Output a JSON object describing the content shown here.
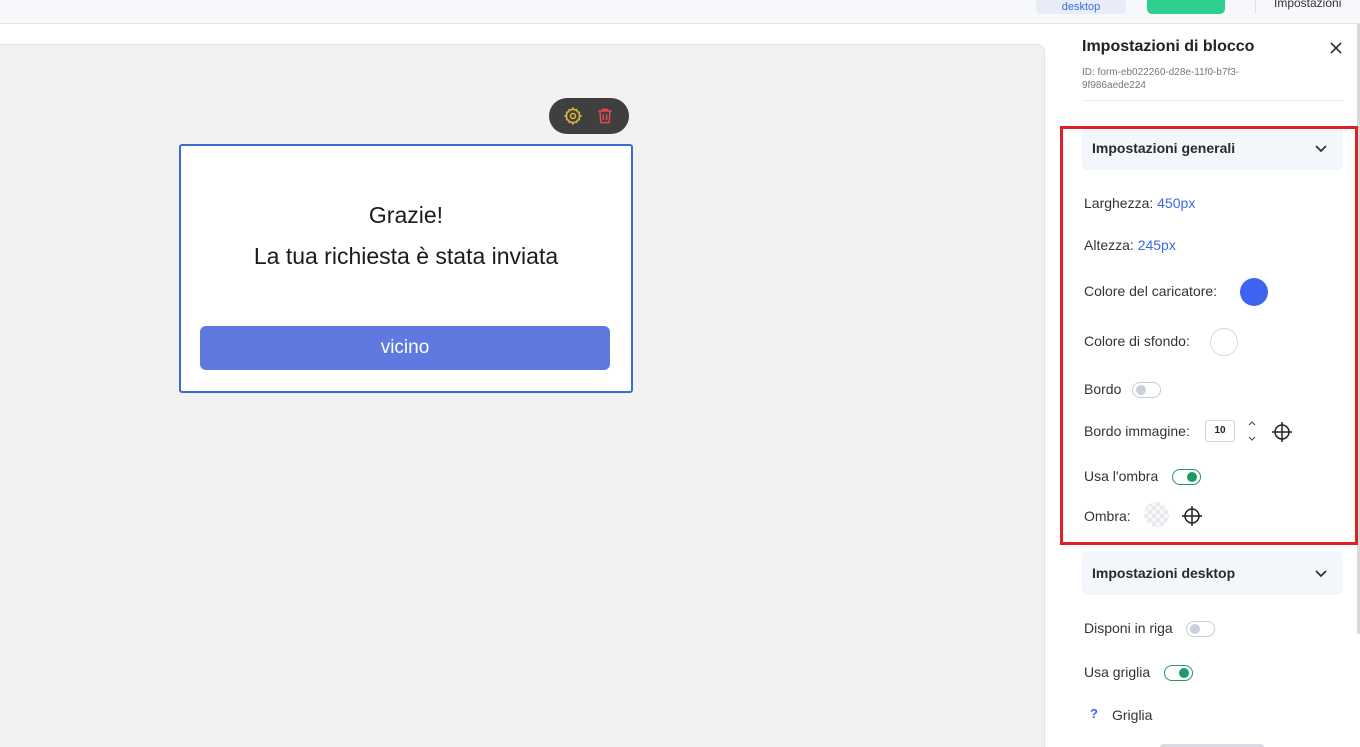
{
  "topbar": {
    "desktop_label": "desktop",
    "settings_label": "Impostazioni"
  },
  "form": {
    "title_line1": "Grazie!",
    "title_line2": "La tua richiesta è stata inviata",
    "button_label": "vicino"
  },
  "panel": {
    "title": "Impostazioni di blocco",
    "id_text": "ID: form-eb022260-d28e-11f0-b7f3-9f986aede224",
    "general": {
      "header": "Impostazioni generali",
      "width_label": "Larghezza:",
      "width_value": "450px",
      "height_label": "Altezza:",
      "height_value": "245px",
      "loader_color_label": "Colore del caricatore:",
      "loader_color": "#3d63f0",
      "bg_color_label": "Colore di sfondo:",
      "bg_color": "#ffffff",
      "border_label": "Bordo",
      "border_on": false,
      "image_border_label": "Bordo immagine:",
      "image_border_value": "10",
      "shadow_use_label": "Usa l'ombra",
      "shadow_use_on": true,
      "shadow_label": "Ombra:"
    },
    "desktop": {
      "header": "Impostazioni desktop",
      "row_layout_label": "Disponi in riga",
      "row_layout_on": false,
      "use_grid_label": "Usa griglia",
      "use_grid_on": true,
      "grid_label": "Griglia",
      "help_glyph": "?"
    }
  },
  "colors": {
    "accent_blue": "#3a6be0",
    "highlight_red": "#e01f26",
    "toggle_green": "#1e9a62",
    "form_button": "#6079e0"
  }
}
